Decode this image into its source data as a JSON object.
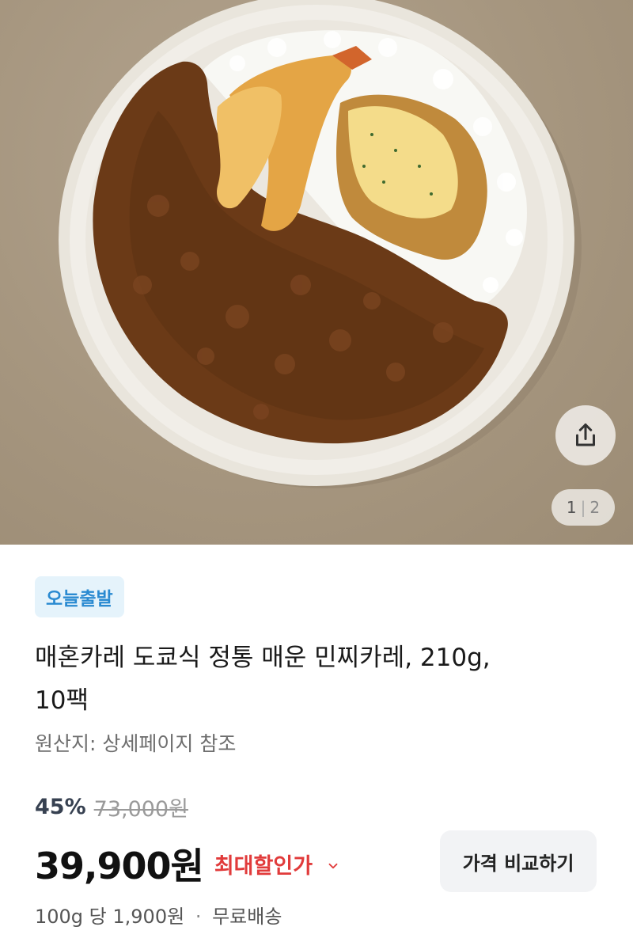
{
  "gallery": {
    "current": "1",
    "separator": "|",
    "total": "2",
    "share_icon": "share-icon"
  },
  "product": {
    "badge": "오늘출발",
    "title_line1": "매혼카레 도쿄식 정통 매운 민찌카레, 210g,",
    "title_line2": "10팩",
    "origin": "원산지: 상세페이지 참조",
    "discount_rate": "45%",
    "original_price": "73,000원",
    "price": "39,900원",
    "max_discount_label": "최대할인가",
    "compare_button": "가격 비교하기",
    "unit_price": "100g 당 1,900원",
    "dot": "·",
    "shipping": "무료배송"
  },
  "colors": {
    "badge_bg": "#e5f3fb",
    "badge_text": "#2a8ad1",
    "discount_red": "#e13b3b"
  }
}
